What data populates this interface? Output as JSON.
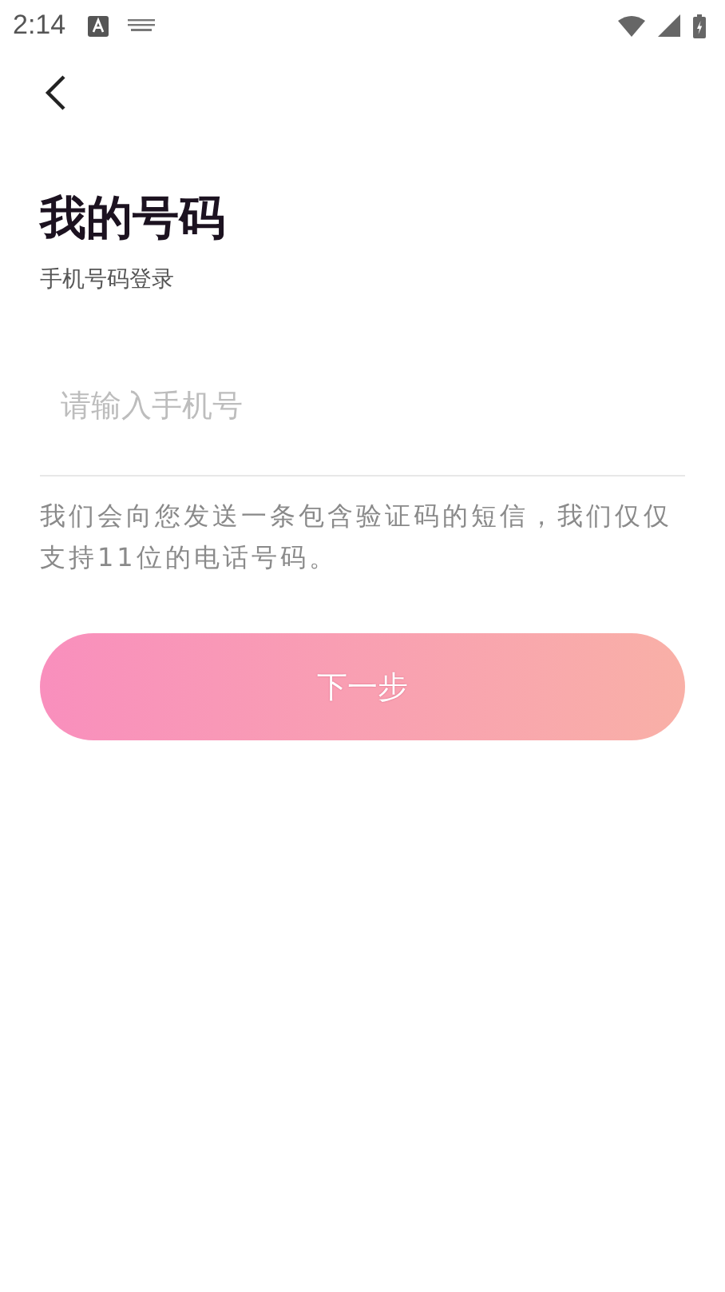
{
  "status_bar": {
    "time": "2:14"
  },
  "title": "我的号码",
  "subtitle": "手机号码登录",
  "phone_field": {
    "placeholder": "请输入手机号"
  },
  "hint": "我们会向您发送一条包含验证码的短信，我们仅仅支持11位的电话号码。",
  "next_button": {
    "label": "下一步",
    "disabled": true
  }
}
